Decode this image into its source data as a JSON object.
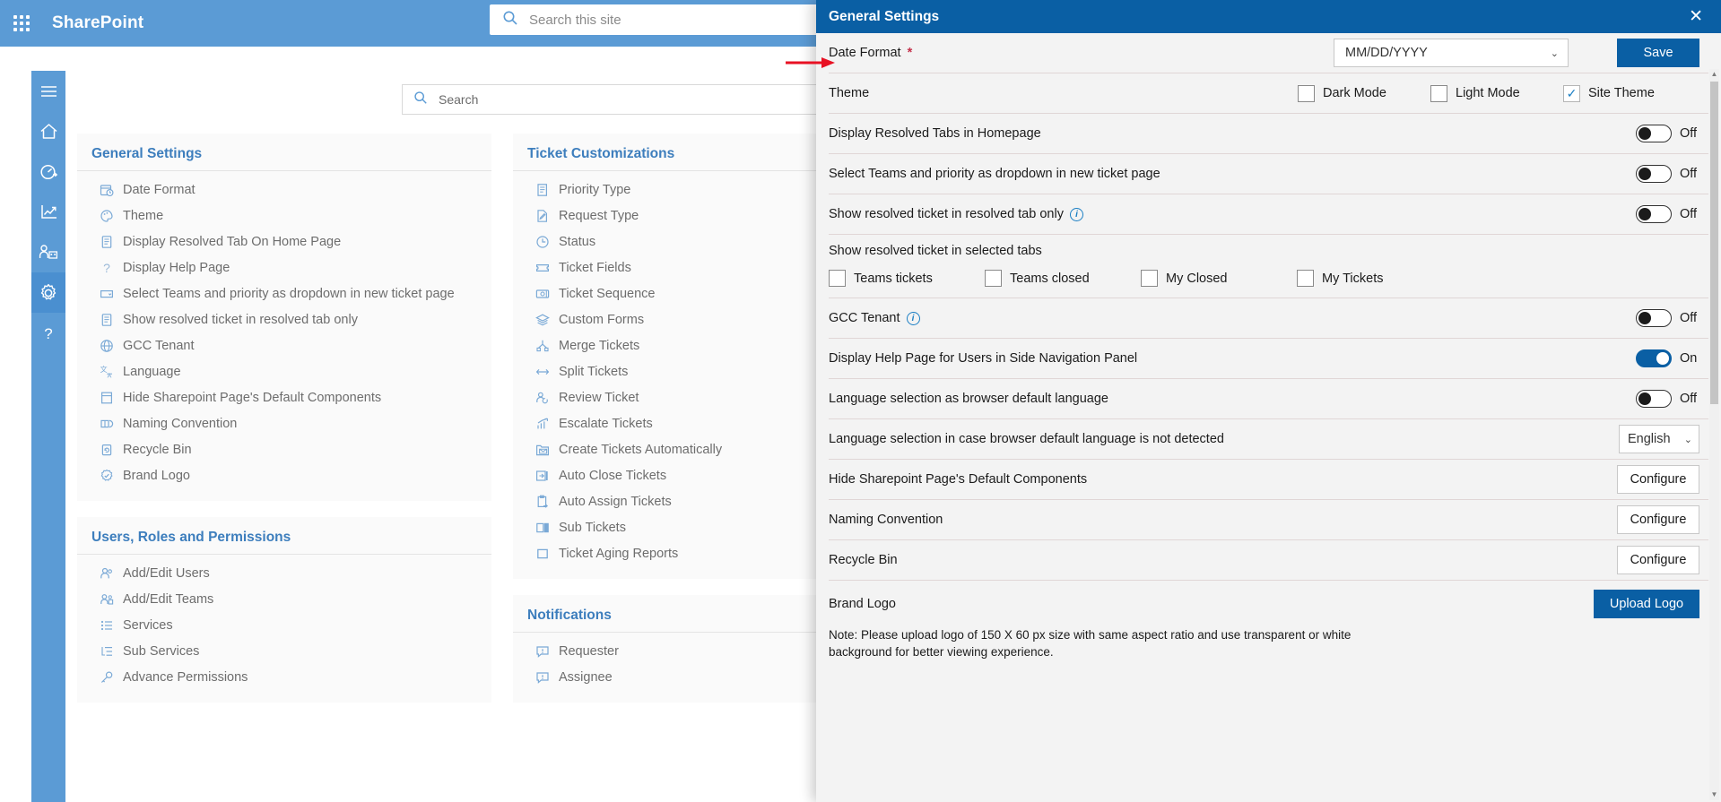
{
  "suitebar": {
    "app_name": "SharePoint",
    "waffle_icon": "app-launcher-icon",
    "search_placeholder": "Search this site",
    "search_icon": "search-icon"
  },
  "rail": {
    "items": [
      {
        "name": "hamburger",
        "icon": "hamburger-menu-icon",
        "active": false
      },
      {
        "name": "home",
        "icon": "home-icon",
        "active": false
      },
      {
        "name": "dashboard",
        "icon": "gauge-icon",
        "active": false
      },
      {
        "name": "reports",
        "icon": "chart-line-icon",
        "active": false
      },
      {
        "name": "teams",
        "icon": "people-team-icon",
        "active": false
      },
      {
        "name": "settings",
        "icon": "gear-icon",
        "active": true
      },
      {
        "name": "help",
        "icon": "question-mark-icon",
        "active": false
      }
    ]
  },
  "page_search": {
    "placeholder": "Search",
    "icon": "search-icon"
  },
  "columns": [
    {
      "cards": [
        {
          "title": "General Settings",
          "items": [
            {
              "label": "Date Format",
              "icon": "calendar-clock-icon"
            },
            {
              "label": "Theme",
              "icon": "palette-icon"
            },
            {
              "label": "Display Resolved Tab On Home Page",
              "icon": "document-icon"
            },
            {
              "label": "Display Help Page",
              "icon": "question-mark-icon"
            },
            {
              "label": "Select Teams and priority as dropdown in new ticket page",
              "icon": "dropdown-box-icon"
            },
            {
              "label": "Show resolved ticket in resolved tab only",
              "icon": "document-icon"
            },
            {
              "label": "GCC Tenant",
              "icon": "globe-icon"
            },
            {
              "label": "Language",
              "icon": "translate-icon"
            },
            {
              "label": "Hide Sharepoint Page's Default Components",
              "icon": "page-layout-icon"
            },
            {
              "label": "Naming Convention",
              "icon": "rename-icon"
            },
            {
              "label": "Recycle Bin",
              "icon": "recycle-bin-icon"
            },
            {
              "label": "Brand Logo",
              "icon": "badge-icon"
            }
          ]
        },
        {
          "title": "Users, Roles and Permissions",
          "items": [
            {
              "label": "Add/Edit Users",
              "icon": "people-icon"
            },
            {
              "label": "Add/Edit Teams",
              "icon": "people-team-icon"
            },
            {
              "label": "Services",
              "icon": "list-icon"
            },
            {
              "label": "Sub Services",
              "icon": "sub-list-icon"
            },
            {
              "label": "Advance Permissions",
              "icon": "key-icon"
            }
          ]
        }
      ]
    },
    {
      "cards": [
        {
          "title": "Ticket Customizations",
          "items": [
            {
              "label": "Priority Type",
              "icon": "task-list-icon"
            },
            {
              "label": "Request Type",
              "icon": "edit-document-icon"
            },
            {
              "label": "Status",
              "icon": "clock-icon"
            },
            {
              "label": "Ticket Fields",
              "icon": "ticket-icon"
            },
            {
              "label": "Ticket Sequence",
              "icon": "sequence-icon"
            },
            {
              "label": "Custom Forms",
              "icon": "layers-icon"
            },
            {
              "label": "Merge Tickets",
              "icon": "merge-icon"
            },
            {
              "label": "Split Tickets",
              "icon": "split-arrows-icon"
            },
            {
              "label": "Review Ticket",
              "icon": "person-sync-icon"
            },
            {
              "label": "Escalate Tickets",
              "icon": "chart-up-icon"
            },
            {
              "label": "Create Tickets Automatically",
              "icon": "mail-folder-icon"
            },
            {
              "label": "Auto Close Tickets",
              "icon": "exit-icon"
            },
            {
              "label": "Auto Assign Tickets",
              "icon": "clipboard-arrow-icon"
            },
            {
              "label": "Sub Tickets",
              "icon": "columns-icon"
            },
            {
              "label": "Ticket Aging Reports",
              "icon": "square-icon"
            }
          ]
        },
        {
          "title": "Notifications",
          "items": [
            {
              "label": "Requester",
              "icon": "comment-alert-icon"
            },
            {
              "label": "Assignee",
              "icon": "comment-alert-icon"
            }
          ]
        }
      ]
    }
  ],
  "panel": {
    "title": "General Settings",
    "close_icon": "close-icon",
    "date_format": {
      "label": "Date Format",
      "required_marker": "*",
      "value": "MM/DD/YYYY",
      "save_label": "Save",
      "caret_icon": "chevron-down-icon",
      "annotation_icon": "red-arrow-pointer"
    },
    "theme": {
      "label": "Theme",
      "options": [
        {
          "label": "Dark Mode",
          "checked": false
        },
        {
          "label": "Light Mode",
          "checked": false
        },
        {
          "label": "Site Theme",
          "checked": true
        }
      ],
      "check_glyph": "✓"
    },
    "toggles": [
      {
        "label": "Display Resolved Tabs in Homepage",
        "state": "Off",
        "on": false,
        "info": false
      },
      {
        "label": "Select Teams and priority as dropdown in new ticket page",
        "state": "Off",
        "on": false,
        "info": false
      },
      {
        "label": "Show resolved ticket in resolved tab only",
        "state": "Off",
        "on": false,
        "info": true
      }
    ],
    "selected_tabs": {
      "title": "Show resolved ticket in selected tabs",
      "options": [
        {
          "label": "Teams tickets",
          "checked": false
        },
        {
          "label": "Teams closed",
          "checked": false
        },
        {
          "label": "My Closed",
          "checked": false
        },
        {
          "label": "My Tickets",
          "checked": false
        }
      ]
    },
    "gcc": {
      "label": "GCC Tenant",
      "state": "Off",
      "on": false,
      "info": true
    },
    "help_page": {
      "label": "Display Help Page for Users in Side Navigation Panel",
      "state": "On",
      "on": true
    },
    "browser_lang": {
      "label": "Language selection as browser default language",
      "state": "Off",
      "on": false
    },
    "fallback_lang": {
      "label": "Language selection in case browser default language is not detected",
      "value": "English",
      "caret_icon": "chevron-down-icon"
    },
    "configure_rows": [
      {
        "label": "Hide Sharepoint Page's Default Components",
        "button": "Configure"
      },
      {
        "label": "Naming Convention",
        "button": "Configure"
      },
      {
        "label": "Recycle Bin",
        "button": "Configure"
      }
    ],
    "brand_logo": {
      "label": "Brand Logo",
      "button": "Upload Logo",
      "note": "Note: Please upload logo of 150 X 60 px size with same aspect ratio and use transparent or white background for better viewing experience."
    },
    "scrollbar": {
      "up_icon": "scroll-up-arrow-icon",
      "down_icon": "scroll-down-arrow-icon"
    }
  },
  "colors": {
    "suite_blue": "#5b9bd5",
    "panel_blue": "#0a5fa4",
    "accent_link": "#3d7ebd",
    "toggle_on": "#0a5fa4",
    "arrow_red": "#e81123"
  }
}
